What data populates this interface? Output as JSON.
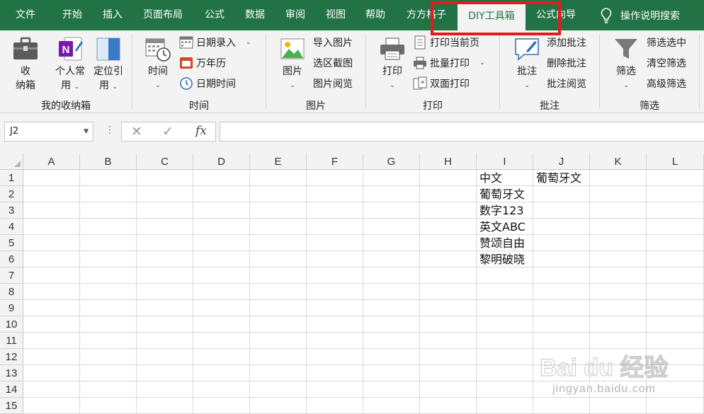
{
  "tabs": [
    {
      "label": "文件",
      "active": false
    },
    {
      "label": "开始",
      "active": false
    },
    {
      "label": "插入",
      "active": false
    },
    {
      "label": "页面布局",
      "active": false
    },
    {
      "label": "公式",
      "active": false
    },
    {
      "label": "数据",
      "active": false
    },
    {
      "label": "审阅",
      "active": false
    },
    {
      "label": "视图",
      "active": false
    },
    {
      "label": "帮助",
      "active": false
    },
    {
      "label": "方方格子",
      "active": false
    },
    {
      "label": "DIY工具箱",
      "active": true
    },
    {
      "label": "公式向导",
      "active": false
    }
  ],
  "help_search": "操作说明搜索",
  "ribbon": {
    "groups": {
      "storage": "我的收纳箱",
      "time": "时间",
      "picture": "图片",
      "print": "打印",
      "comment": "批注",
      "filter": "筛选"
    },
    "storage_box": {
      "line1": "收",
      "line2": "纳箱"
    },
    "personal": {
      "line1": "个人常",
      "line2": "用"
    },
    "locate": {
      "line1": "定位引",
      "line2": "用"
    },
    "time_btn": "时间",
    "date_entry": "日期录入",
    "calendar": "万年历",
    "date_time": "日期时间",
    "picture_btn": "图片",
    "import_picture": "导入图片",
    "region_screenshot": "选区截图",
    "picture_browse": "图片阅览",
    "print_btn": "打印",
    "print_current_page": "打印当前页",
    "batch_print": "批量打印",
    "duplex_print": "双面打印",
    "comment_btn": "批注",
    "add_comment": "添加批注",
    "delete_comment": "删除批注",
    "comment_browse": "批注阅览",
    "filter_btn": "筛选",
    "filter_selected": "筛选选中",
    "clear_empty_filter": "清空筛选",
    "advanced_filter": "高级筛选"
  },
  "formula_bar": {
    "name_box": "J2",
    "cancel_symbol": "✕",
    "enter_symbol": "✓",
    "fx_label": "fx",
    "formula_value": ""
  },
  "grid": {
    "columns": [
      "A",
      "B",
      "C",
      "D",
      "E",
      "F",
      "G",
      "H",
      "I",
      "J",
      "K",
      "L"
    ],
    "rows": [
      "1",
      "2",
      "3",
      "4",
      "5",
      "6",
      "7",
      "8",
      "9",
      "10",
      "11",
      "12",
      "13",
      "14",
      "15"
    ],
    "cells": {
      "I1": "中文",
      "J1": "葡萄牙文",
      "I2": "葡萄牙文",
      "I3": "数字123",
      "I4": "英文ABC",
      "I5": "赞颂自由",
      "I6": "黎明破晓"
    }
  },
  "watermark": {
    "logo_text": "Bai du 经验",
    "url_text": "jingyan.baidu.com"
  },
  "colors": {
    "excel_green": "#217346",
    "highlight_red": "#e8191c",
    "ribbon_bg": "#f3f3f3"
  }
}
